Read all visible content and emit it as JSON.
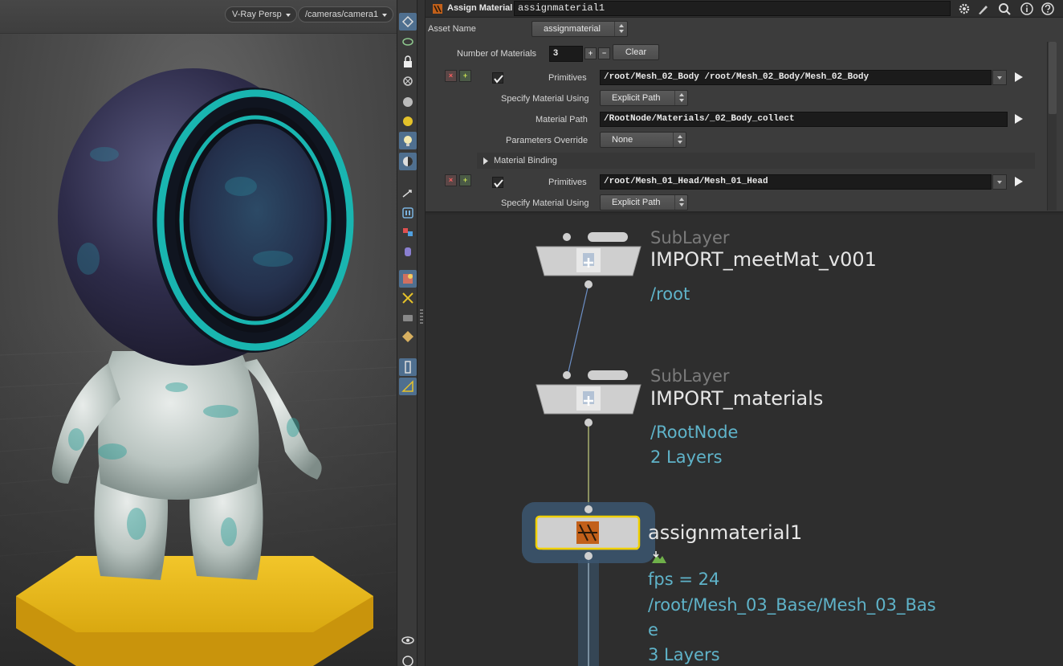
{
  "viewport": {
    "camera_menu": "V-Ray Persp",
    "camera_path_menu": "/cameras/camera1"
  },
  "parameters": {
    "node_type": "Assign Material",
    "node_name": "assignmaterial1",
    "asset_name": {
      "label": "Asset Name",
      "value": "assignmaterial"
    },
    "number_of_materials": {
      "label": "Number of Materials",
      "value": "3",
      "plus": "+",
      "minus": "−",
      "clear": "Clear"
    },
    "remove_glyph": "×",
    "insert_glyph": "+",
    "entry1": {
      "primitives_label": "Primitives",
      "primitives_value": "/root/Mesh_02_Body /root/Mesh_02_Body/Mesh_02_Body",
      "specify_label": "Specify Material Using",
      "specify_value": "Explicit Path",
      "material_path_label": "Material Path",
      "material_path_value": "/RootNode/Materials/_02_Body_collect",
      "override_label": "Parameters Override",
      "override_value": "None",
      "binding_label": "Material Binding"
    },
    "entry2": {
      "primitives_label": "Primitives",
      "primitives_value": "/root/Mesh_01_Head/Mesh_01_Head",
      "specify_label": "Specify Material Using",
      "specify_value": "Explicit Path"
    }
  },
  "network": {
    "nodes": [
      {
        "category": "SubLayer",
        "name": "IMPORT_meetMat_v001",
        "info": [
          "/root"
        ]
      },
      {
        "category": "SubLayer",
        "name": "IMPORT_materials",
        "info": [
          "/RootNode",
          "2 Layers"
        ]
      },
      {
        "category": "",
        "name": "assignmaterial1",
        "info": [
          "fps = 24",
          "/root/Mesh_03_Base/Mesh_03_Bas",
          "e",
          "3 Layers"
        ]
      }
    ]
  },
  "colors": {
    "accent_selected": "#f0d000",
    "info_text": "#5fb3c9",
    "helmet_rim": "#19b5b0",
    "base_yellow": "#f0c020"
  }
}
